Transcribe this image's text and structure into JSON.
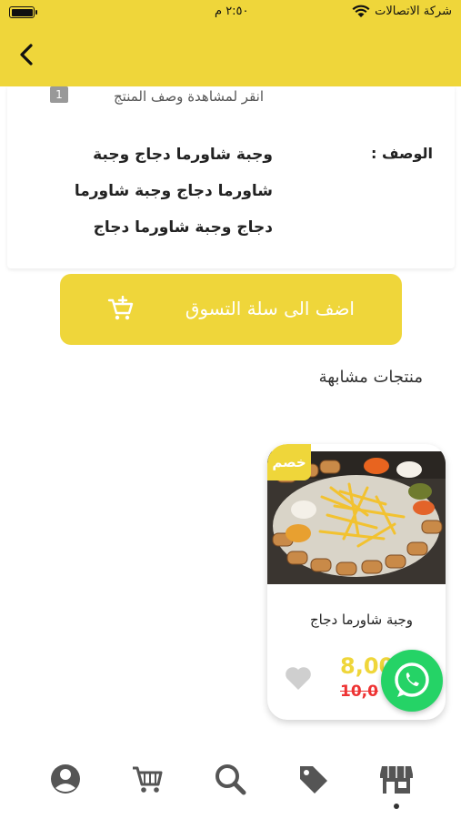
{
  "status_bar": {
    "carrier": "شركة الاتصالات",
    "time": "٢:٥٠ م"
  },
  "description": {
    "tap_hint": "انقر لمشاهدة وصف المنتج",
    "tap_badge": "1",
    "label": "الوصف :",
    "text": "وجبة شاورما دجاج وجبة شاورما دجاج وجبة شاورما دجاج وجبة شاورما دجاج"
  },
  "add_to_cart": {
    "label": "اضف الى سلة التسوق",
    "icon": "cart-plus-icon"
  },
  "similar": {
    "title": "منتجات مشابهة",
    "products": [
      {
        "badge": "خصم",
        "name": "وجبة شاورما دجاج",
        "price_new": "8,00",
        "price_old": "10,0"
      }
    ]
  },
  "bottom_nav": {
    "items": [
      "profile-icon",
      "cart-icon",
      "search-icon",
      "tag-icon",
      "store-icon"
    ],
    "active": "store-icon"
  },
  "colors": {
    "accent": "#efd63a",
    "old_price": "#ee3333",
    "whatsapp": "#25d366"
  }
}
